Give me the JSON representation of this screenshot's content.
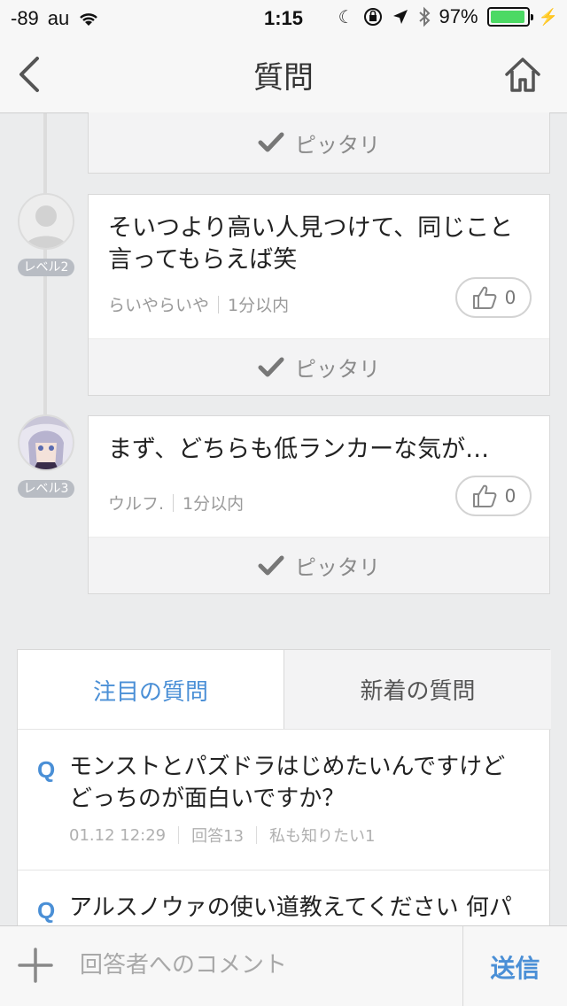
{
  "status_bar": {
    "signal": "-89",
    "carrier": "au",
    "time": "1:15",
    "battery_percent": "97%",
    "battery_level": 0.97
  },
  "nav": {
    "title": "質問",
    "back_icon": "chevron-left-icon",
    "home_icon": "home-icon"
  },
  "answers": [
    {
      "footer_label": "ピッタリ"
    },
    {
      "level": "レベル2",
      "text": "そいつより高い人見つけて、同じこと言ってもらえば笑",
      "user": "らいやらいや",
      "time": "1分以内",
      "likes": "0",
      "footer_label": "ピッタリ"
    },
    {
      "level": "レベル3",
      "text": "まず、どちらも低ランカーな気が…",
      "user": "ウルフ.",
      "time": "1分以内",
      "likes": "0",
      "footer_label": "ピッタリ"
    }
  ],
  "tabs": {
    "active": "注目の質問",
    "inactive": "新着の質問"
  },
  "questions": [
    {
      "mark": "Q",
      "text": "モンストとパズドラはじめたいんですけどどっちのが面白いですか？",
      "date": "01.12 12:29",
      "answers": "回答13",
      "me_too": "私も知りたい1"
    },
    {
      "mark": "Q",
      "text": "アルスノウァの使い道教えてください 何パ"
    }
  ],
  "comment_bar": {
    "placeholder": "回答者へのコメント",
    "send_label": "送信"
  },
  "colors": {
    "accent": "#4a8fd6",
    "background": "#ebeced",
    "battery": "#4cd964"
  }
}
